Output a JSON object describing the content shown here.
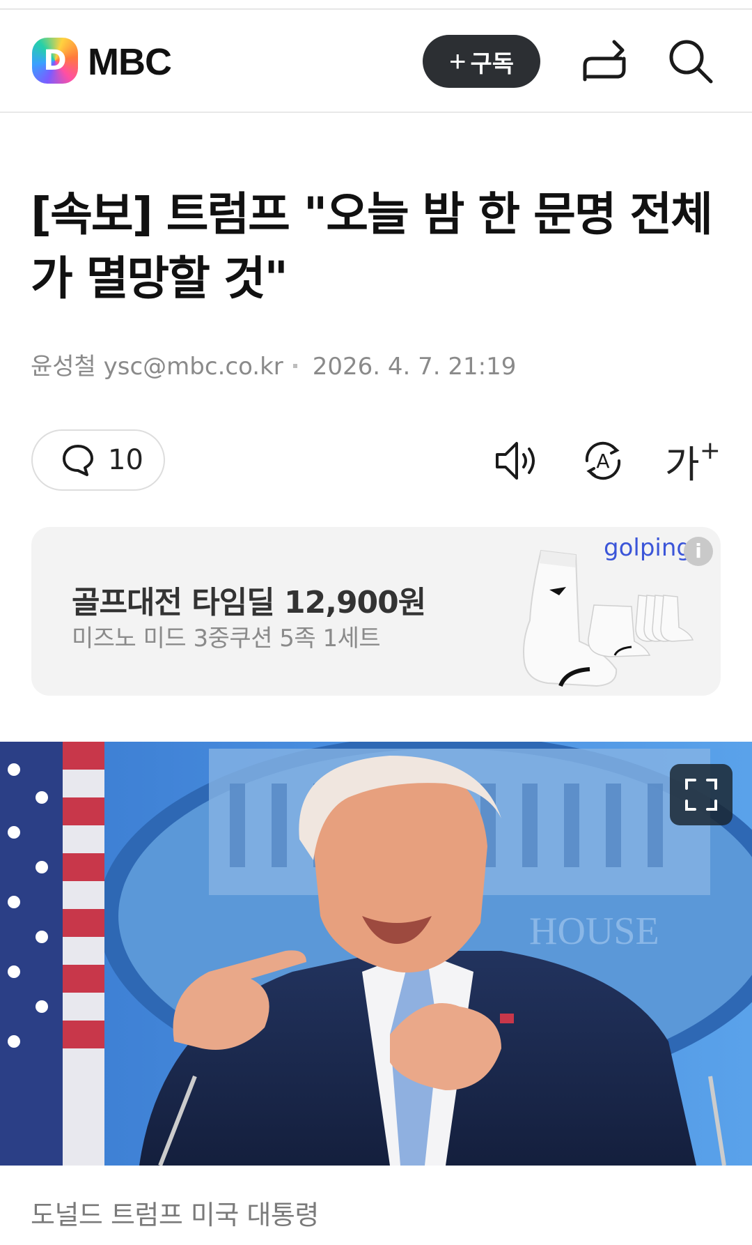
{
  "header": {
    "logo_letter": "D",
    "press_name": "MBC",
    "subscribe_label": "구독",
    "subscribe_plus": "+",
    "icons": [
      "share-icon",
      "search-icon"
    ]
  },
  "article": {
    "title": "[속보] 트럼프 \"오늘 밤 한 문명 전체가 멸망할 것\"",
    "author": "윤성철",
    "email": "ysc@mbc.co.kr",
    "datetime": "2026. 4. 7. 21:19"
  },
  "toolbar": {
    "comment_count": "10",
    "font_size_label": "가",
    "font_size_plus": "+",
    "translate_letter": "A",
    "icons": [
      "comment-icon",
      "speaker-icon",
      "translate-icon",
      "font-size-icon"
    ]
  },
  "ad": {
    "title": "골프대전 타임딜 12,900원",
    "subtitle": "미즈노 미드 3중쿠션 5족 1세트",
    "brand": "golping",
    "info": "i"
  },
  "photo": {
    "caption": "도널드 트럼프 미국 대통령",
    "icons": [
      "expand-icon"
    ]
  },
  "colors": {
    "subscribe_bg": "#2c2f33",
    "ad_bg": "#f3f3f3",
    "ad_brand": "#3b55d8",
    "meta_text": "#8a8a8a"
  }
}
